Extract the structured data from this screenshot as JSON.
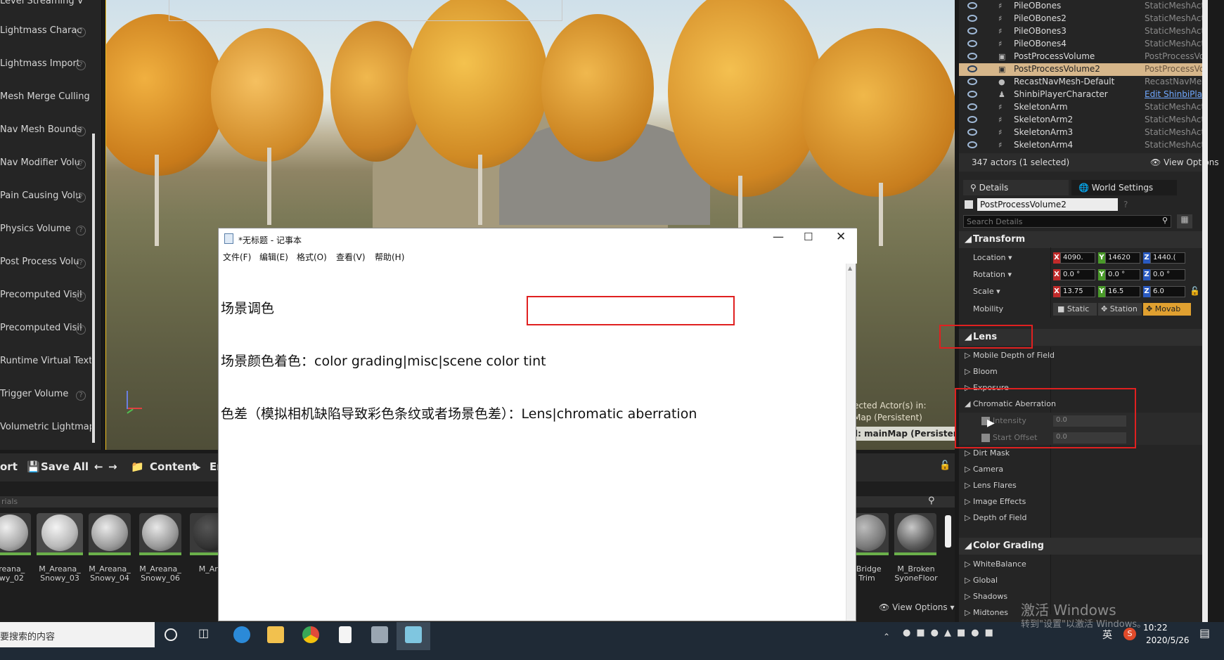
{
  "left_panel": {
    "items": [
      "Level Streaming V",
      "Lightmass Charac",
      "Lightmass Import",
      "Mesh Merge Culling V",
      "Nav Mesh Bounds",
      "Nav Modifier Volu",
      "Pain Causing Volu",
      "Physics Volume",
      "Post Process Volu",
      "Precomputed Visil",
      "Precomputed Visil",
      "Runtime Virtual Textu",
      "Trigger Volume",
      "Volumetric Lightmap I"
    ]
  },
  "viewport": {
    "overlay_line1": "ected Actor(s) in:",
    "overlay_line2": "Map (Persistent)",
    "level_badge": "l:  mainMap (Persistent)"
  },
  "content_browser": {
    "toolbar": {
      "import_label": "ort",
      "save_all_label": "Save All",
      "content_label": "Content",
      "path_fragment": "Er"
    },
    "search_placeholder": "rials",
    "assets_left": [
      {
        "label_line1": "Areana_",
        "label_line2": "owy_02"
      },
      {
        "label_line1": "M_Areana_",
        "label_line2": "Snowy_03"
      },
      {
        "label_line1": "M_Areana_",
        "label_line2": "Snowy_04"
      },
      {
        "label_line1": "M_Areana_",
        "label_line2": "Snowy_06"
      },
      {
        "label_line1": "M_Arti",
        "label_line2": ""
      }
    ],
    "assets_right": [
      {
        "label_line1": "_Bridge",
        "label_line2": "Trim"
      },
      {
        "label_line1": "M_Broken",
        "label_line2": "SyoneFloor"
      }
    ],
    "view_options": "View Options"
  },
  "outliner": {
    "rows": [
      {
        "name": "PileOBones",
        "type": "StaticMeshActor"
      },
      {
        "name": "PileOBones2",
        "type": "StaticMeshActor"
      },
      {
        "name": "PileOBones3",
        "type": "StaticMeshActor"
      },
      {
        "name": "PileOBones4",
        "type": "StaticMeshActor"
      },
      {
        "name": "PostProcessVolume",
        "type": "PostProcessVolume"
      },
      {
        "name": "PostProcessVolume2",
        "type": "PostProcessVolume"
      },
      {
        "name": "RecastNavMesh-Default",
        "type": "RecastNavMesh"
      },
      {
        "name": "ShinbiPlayerCharacter",
        "type": "Edit ShinbiPlayer"
      },
      {
        "name": "SkeletonArm",
        "type": "StaticMeshActor"
      },
      {
        "name": "SkeletonArm2",
        "type": "StaticMeshActor"
      },
      {
        "name": "SkeletonArm3",
        "type": "StaticMeshActor"
      },
      {
        "name": "SkeletonArm4",
        "type": "StaticMeshActor"
      }
    ],
    "actor_count": "347 actors (1 selected)",
    "view_options": "View Options"
  },
  "details": {
    "tab_details": "Details",
    "tab_world": "World Settings",
    "actor_name": "PostProcessVolume2",
    "search_placeholder": "Search Details",
    "transform": {
      "header": "Transform",
      "location_label": "Location",
      "rotation_label": "Rotation",
      "scale_label": "Scale",
      "mobility_label": "Mobility",
      "location": [
        "4090.",
        "14620",
        "1440.("
      ],
      "rotation": [
        "0.0 °",
        "0.0 °",
        "0.0 °"
      ],
      "scale": [
        "13.75",
        "16.5",
        "6.0"
      ],
      "mobility_options": [
        "Static",
        "Station",
        "Movab"
      ],
      "axes": [
        "X",
        "Y",
        "Z"
      ]
    },
    "lens": {
      "header": "Lens",
      "items_before": [
        "Mobile Depth of Field",
        "Bloom",
        "Exposure"
      ],
      "chromatic_header": "Chromatic Aberration",
      "intensity_label": "Intensity",
      "intensity_value": "0.0",
      "start_offset_label": "Start Offset",
      "start_offset_value": "0.0",
      "items_after": [
        "Dirt Mask",
        "Camera",
        "Lens Flares",
        "Image Effects",
        "Depth of Field"
      ]
    },
    "color_grading": {
      "header": "Color Grading",
      "items": [
        "WhiteBalance",
        "Global",
        "Shadows",
        "Midtones"
      ]
    }
  },
  "notepad": {
    "title": "*无标题 - 记事本",
    "menu": [
      "文件(F)",
      "编辑(E)",
      "格式(O)",
      "查看(V)",
      "帮助(H)"
    ],
    "lines": [
      "场景调色",
      "场景颜色着色：color grading|misc|scene color tint",
      "色差（模拟相机缺陷导致彩色条纹或者场景色差）：Lens|chromatic aberration"
    ]
  },
  "taskbar": {
    "search_text": "要搜索的内容",
    "clock_time": "10:22",
    "clock_date": "2020/5/26",
    "ime": "英",
    "watermark_line1": "激活 Windows",
    "watermark_line2": "转到\"设置\"以激活 Windows。"
  },
  "colors": {
    "highlight_red": "#e02020",
    "selection": "#d6b68a",
    "accent_blue": "#6fa8ff"
  }
}
